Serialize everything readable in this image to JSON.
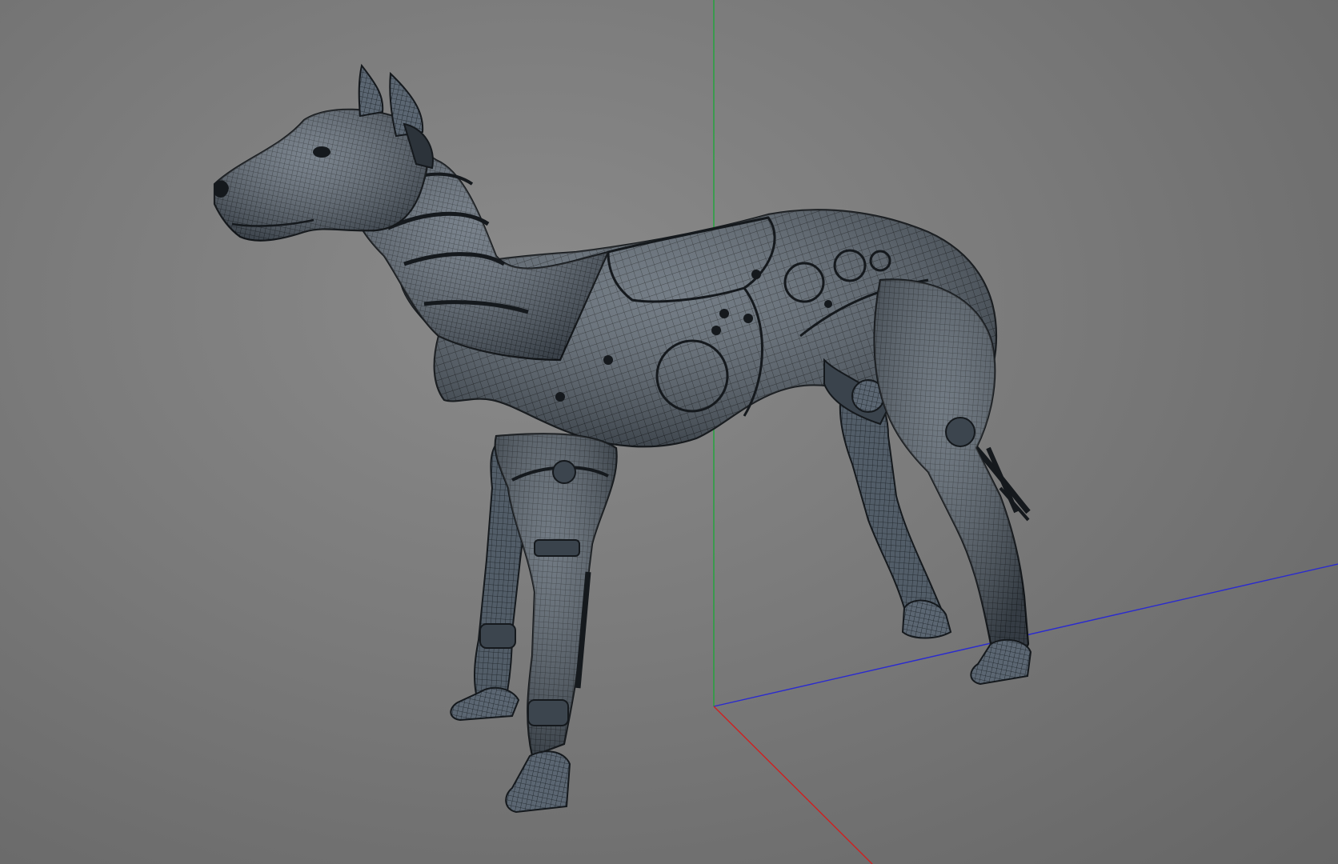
{
  "viewport": {
    "background_color": "#7a7a7a",
    "model_subject": "robotic-dog-wireframe",
    "wire_color": "#1c2126",
    "shell_color": "#4d5863",
    "shell_highlight": "#74808b"
  },
  "axes": {
    "x_axis_color": "#d02020",
    "y_axis_color": "#1fa63a",
    "z_axis_color": "#2a2ad0"
  }
}
